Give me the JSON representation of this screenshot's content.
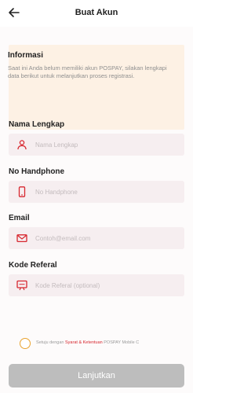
{
  "header": {
    "title": "Buat Akun",
    "back_icon": "arrow-left-icon"
  },
  "info": {
    "title": "Informasi",
    "text": "Saat ini Anda belum memiliki akun POSPAY, silakan lengkapi data berikut untuk melanjutkan proses registrasi."
  },
  "fields": {
    "name": {
      "label": "Nama Lengkap",
      "placeholder": "Nama Lengkap",
      "icon": "person-icon"
    },
    "phone": {
      "label": "No Handphone",
      "placeholder": "No Handphone",
      "icon": "phone-icon"
    },
    "email": {
      "label": "Email",
      "placeholder": "Contoh@email.com",
      "icon": "mail-icon"
    },
    "referral": {
      "label": "Kode Referal",
      "placeholder": "Kode Referal (optional)",
      "icon": "referral-icon"
    }
  },
  "terms": {
    "prefix": "Setuju dengan ",
    "link": "Syarat & Ketentuan",
    "suffix": " POSPAY Mobile C"
  },
  "submit": {
    "label": "Lanjutkan"
  },
  "colors": {
    "accent": "#d7272f",
    "info_bg": "#fdf1e4",
    "checkbox": "#e9a22e",
    "button_disabled": "#bdbdbd"
  }
}
